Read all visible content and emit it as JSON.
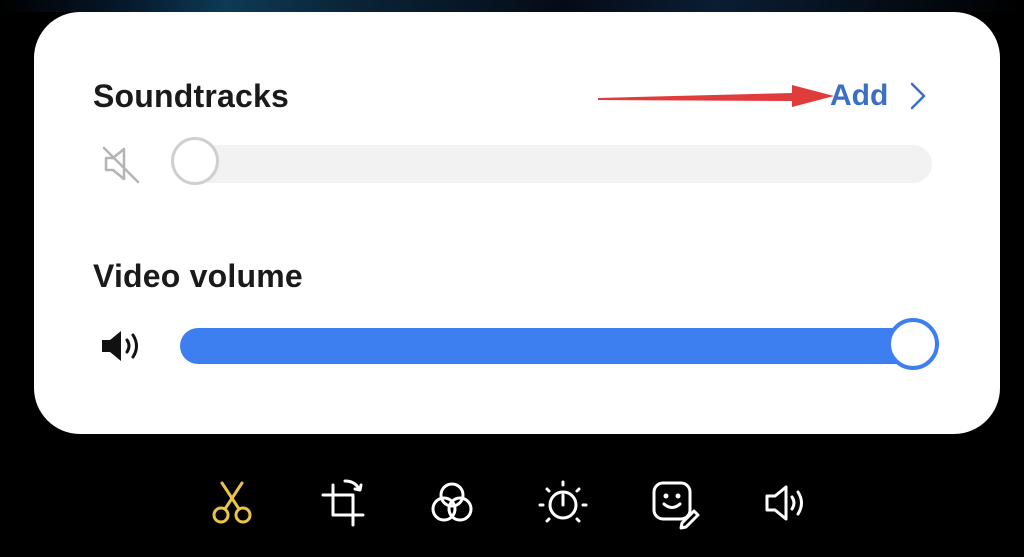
{
  "soundtracks": {
    "title": "Soundtracks",
    "add_label": "Add",
    "add_icon": "chevron-right-icon",
    "mute_icon": "speaker-muted-icon",
    "level": 0
  },
  "video_volume": {
    "title": "Video volume",
    "speaker_icon": "speaker-icon",
    "level": 1.0
  },
  "annotation": {
    "arrow_color": "#e03c3c"
  },
  "toolbar": {
    "tools": [
      {
        "icon": "scissors-icon",
        "active": true
      },
      {
        "icon": "crop-rotate-icon",
        "active": false
      },
      {
        "icon": "filter-circles-icon",
        "active": false
      },
      {
        "icon": "brightness-icon",
        "active": false
      },
      {
        "icon": "sticker-icon",
        "active": false
      },
      {
        "icon": "volume-icon",
        "active": false
      }
    ],
    "active_color": "#e8c54a",
    "icon_color": "#ffffff"
  },
  "colors": {
    "accent": "#3d7ef0",
    "link": "#3b6fc4",
    "panel_bg": "#ffffff",
    "background": "#000000"
  }
}
